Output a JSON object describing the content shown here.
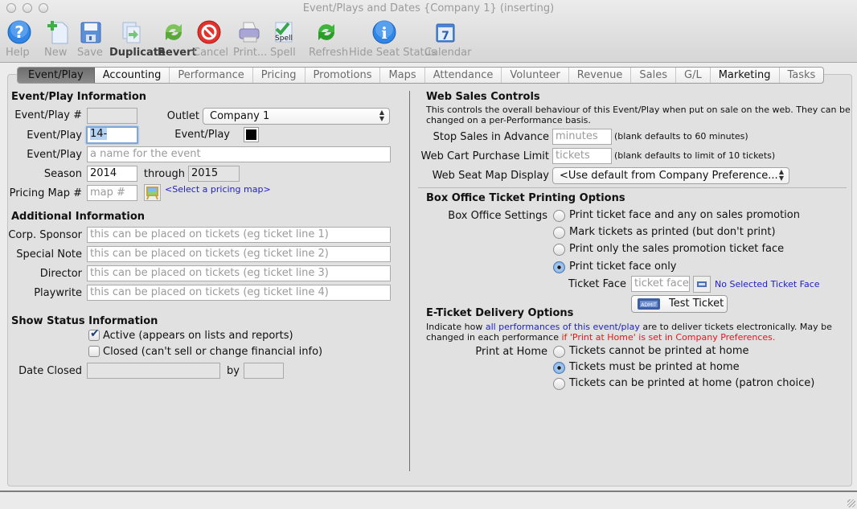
{
  "window": {
    "title": "Event/Plays and Dates {Company 1} (inserting)"
  },
  "toolbar": [
    {
      "id": "help",
      "label": "Help",
      "icon": "help-icon",
      "enabled": false
    },
    {
      "id": "new",
      "label": "New",
      "icon": "new-document-icon",
      "enabled": false
    },
    {
      "id": "save",
      "label": "Save",
      "icon": "floppy-disk-icon",
      "enabled": false
    },
    {
      "id": "duplicate",
      "label": "Duplicate",
      "icon": "duplicate-icon",
      "enabled": true
    },
    {
      "id": "revert",
      "label": "Revert",
      "icon": "revert-arrows-icon",
      "enabled": true
    },
    {
      "id": "cancel",
      "label": "Cancel",
      "icon": "cancel-icon",
      "enabled": false
    },
    {
      "id": "print",
      "label": "Print...",
      "icon": "printer-icon",
      "enabled": false
    },
    {
      "id": "spell",
      "label": "Spell",
      "icon": "spell-check-icon",
      "enabled": false
    },
    {
      "id": "refresh",
      "label": "Refresh",
      "icon": "refresh-icon",
      "enabled": false
    },
    {
      "id": "hide-seat-status",
      "label": "Hide Seat Status",
      "icon": "info-icon",
      "enabled": false
    },
    {
      "id": "calendar",
      "label": "Calendar",
      "icon": "calendar-icon",
      "enabled": false
    }
  ],
  "tabs": [
    {
      "label": "Event/Play",
      "active": true
    },
    {
      "label": "Accounting",
      "active": false,
      "emphasis": true
    },
    {
      "label": "Performance",
      "active": false
    },
    {
      "label": "Pricing",
      "active": false
    },
    {
      "label": "Promotions",
      "active": false
    },
    {
      "label": "Maps",
      "active": false
    },
    {
      "label": "Attendance",
      "active": false
    },
    {
      "label": "Volunteer",
      "active": false
    },
    {
      "label": "Revenue",
      "active": false
    },
    {
      "label": "Sales",
      "active": false
    },
    {
      "label": "G/L",
      "active": false
    },
    {
      "label": "Marketing",
      "active": false,
      "emphasis": true
    },
    {
      "label": "Tasks",
      "active": false
    }
  ],
  "event_info": {
    "heading": "Event/Play Information",
    "number_label": "Event/Play #",
    "number_value": "",
    "outlet_label": "Outlet",
    "outlet_value": "Company 1",
    "code_label": "Event/Play",
    "code_value": "14-",
    "color_label": "Event/Play",
    "color_value": "#000000",
    "name_label": "Event/Play",
    "name_placeholder": "a name for the event",
    "season_label": "Season",
    "season_value": "2014",
    "through_label": "through",
    "through_value": "2015",
    "pricing_map_label": "Pricing Map #",
    "pricing_map_placeholder": "map #",
    "pricing_map_link": "<Select a pricing map>"
  },
  "additional_info": {
    "heading": "Additional Information",
    "fields": [
      {
        "label": "Corp. Sponsor",
        "placeholder": "this can be placed on tickets (eg ticket line 1)"
      },
      {
        "label": "Special Note",
        "placeholder": "this can be placed on tickets (eg ticket line 2)"
      },
      {
        "label": "Director",
        "placeholder": "this can be placed on tickets (eg ticket line 3)"
      },
      {
        "label": "Playwrite",
        "placeholder": "this can be placed on tickets (eg ticket line 4)"
      }
    ]
  },
  "show_status": {
    "heading": "Show Status Information",
    "active_label": "Active (appears on lists and reports)",
    "active_checked": true,
    "closed_label": "Closed (can't sell or change financial info)",
    "closed_checked": false,
    "date_closed_label": "Date Closed",
    "date_closed_value": "",
    "by_label": "by",
    "by_value": ""
  },
  "web_sales": {
    "heading": "Web Sales Controls",
    "description_line1": "This controls the overall behaviour of this Event/Play when put on sale on the web.  They can be",
    "description_line2": "changed on a per-Performance basis.",
    "stop_sales_label": "Stop Sales in Advance",
    "stop_sales_placeholder": "minutes",
    "stop_sales_hint": "(blank defaults to 60 minutes)",
    "cart_limit_label": "Web Cart Purchase Limit",
    "cart_limit_placeholder": "tickets",
    "cart_limit_hint": "(blank defaults to limit of 10 tickets)",
    "seat_map_label": "Web Seat Map Display",
    "seat_map_value": "<Use default from Company Preference..."
  },
  "box_office": {
    "heading": "Box Office Ticket Printing Options",
    "settings_label": "Box Office Settings",
    "options": [
      {
        "label": "Print ticket face and any on sales promotion",
        "selected": false
      },
      {
        "label": "Mark tickets as printed (but don't print)",
        "selected": false
      },
      {
        "label": "Print only the sales promotion ticket face",
        "selected": false
      },
      {
        "label": "Print ticket face only",
        "selected": true
      }
    ],
    "ticket_face_label": "Ticket Face",
    "ticket_face_placeholder": "ticket face",
    "ticket_face_status": "No Selected Ticket Face",
    "test_ticket_label": "Test Ticket"
  },
  "eticket": {
    "heading": "E-Ticket Delivery Options",
    "desc_part1": "Indicate how ",
    "desc_link": "all performances of this event/play",
    "desc_part2": " are to deliver tickets electronically.  May be",
    "desc_line2_part1": "changed in each performance ",
    "desc_line2_red": "if 'Print at Home' is set in Company Preferences.",
    "print_home_label": "Print at Home",
    "options": [
      {
        "label": "Tickets cannot be printed at home",
        "selected": false
      },
      {
        "label": "Tickets must be printed at home",
        "selected": true
      },
      {
        "label": "Tickets can be printed at home (patron choice)",
        "selected": false
      }
    ]
  }
}
